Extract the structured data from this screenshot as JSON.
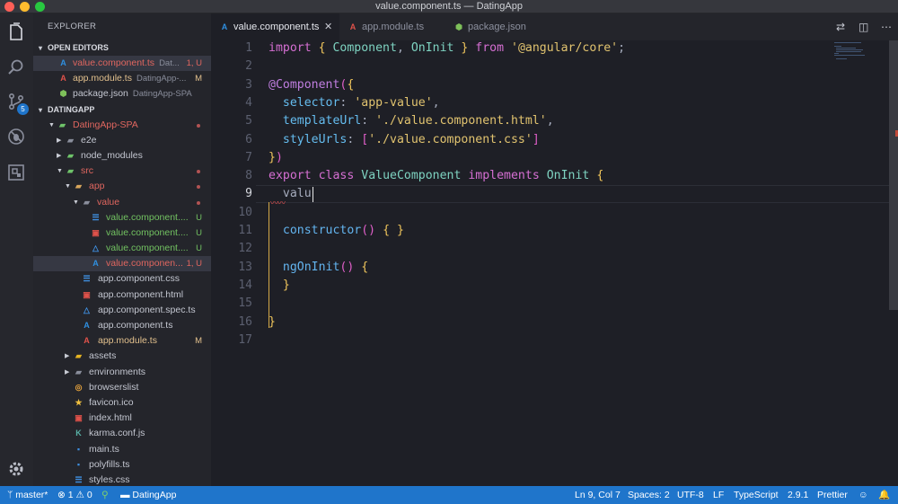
{
  "window": {
    "title": "value.component.ts — DatingApp"
  },
  "activity_bar": {
    "scm_badge": "5"
  },
  "sidebar": {
    "title": "EXPLORER",
    "open_editors": {
      "label": "OPEN EDITORS",
      "items": [
        {
          "name": "value.component.ts",
          "desc": "Dat...",
          "status": "1, U"
        },
        {
          "name": "app.module.ts",
          "desc": "DatingApp-...",
          "status": "M"
        },
        {
          "name": "package.json",
          "desc": "DatingApp-SPA",
          "status": ""
        }
      ]
    },
    "workspace": {
      "label": "DATINGAPP",
      "items": [
        {
          "name": "DatingApp-SPA"
        },
        {
          "name": "e2e"
        },
        {
          "name": "node_modules"
        },
        {
          "name": "src"
        },
        {
          "name": "app"
        },
        {
          "name": "value"
        },
        {
          "name": "value.component....",
          "status": "U"
        },
        {
          "name": "value.component....",
          "status": "U"
        },
        {
          "name": "value.component....",
          "status": "U"
        },
        {
          "name": "value.componen...",
          "status": "1, U"
        },
        {
          "name": "app.component.css"
        },
        {
          "name": "app.component.html"
        },
        {
          "name": "app.component.spec.ts"
        },
        {
          "name": "app.component.ts"
        },
        {
          "name": "app.module.ts",
          "status": "M"
        },
        {
          "name": "assets"
        },
        {
          "name": "environments"
        },
        {
          "name": "browserslist"
        },
        {
          "name": "favicon.ico"
        },
        {
          "name": "index.html"
        },
        {
          "name": "karma.conf.js"
        },
        {
          "name": "main.ts"
        },
        {
          "name": "polyfills.ts"
        },
        {
          "name": "styles.css"
        }
      ]
    }
  },
  "tabs": [
    {
      "label": "value.component.ts",
      "active": true
    },
    {
      "label": "app.module.ts",
      "active": false
    },
    {
      "label": "package.json",
      "active": false
    }
  ],
  "editor": {
    "line_numbers": [
      "1",
      "2",
      "3",
      "4",
      "5",
      "6",
      "7",
      "8",
      "9",
      "10",
      "11",
      "12",
      "13",
      "14",
      "15",
      "16",
      "17"
    ],
    "current_line": "9",
    "lines": [
      [
        "import",
        " { ",
        "Component",
        ", ",
        "OnInit",
        " } ",
        "from",
        " ",
        "'@angular/core'",
        ";"
      ],
      [],
      [
        "@Component",
        "(",
        "{"
      ],
      [
        "  ",
        "selector",
        ": ",
        "'app-value'",
        ","
      ],
      [
        "  ",
        "templateUrl",
        ": ",
        "'./value.component.html'",
        ","
      ],
      [
        "  ",
        "styleUrls",
        ": ",
        "[",
        "'./value.component.css'",
        "]"
      ],
      [
        "}",
        ")"
      ],
      [
        "export",
        " ",
        "class",
        " ",
        "ValueComponent",
        " ",
        "implements",
        " ",
        "OnInit",
        " ",
        "{"
      ],
      [
        "  ",
        "valu"
      ],
      [],
      [
        "  ",
        "constructor",
        "()",
        " ",
        "{",
        " ",
        "}"
      ],
      [],
      [
        "  ",
        "ngOnInit",
        "()",
        " ",
        "{"
      ],
      [
        "  ",
        "}"
      ],
      [],
      [
        "}"
      ],
      []
    ]
  },
  "status_bar": {
    "branch": "master*",
    "errors": "1",
    "warnings": "0",
    "folder": "DatingApp",
    "position": "Ln 9, Col 7",
    "spaces": "Spaces: 2",
    "encoding": "UTF-8",
    "eol": "LF",
    "language": "TypeScript",
    "version": "2.9.1",
    "formatter": "Prettier"
  },
  "colors": {
    "status_bar": "#1f75cb",
    "editor_bg": "#1e1f26",
    "sidebar_bg": "#24252b",
    "untracked": "#72c261",
    "modified": "#e2c08d",
    "error": "#e0665f"
  }
}
